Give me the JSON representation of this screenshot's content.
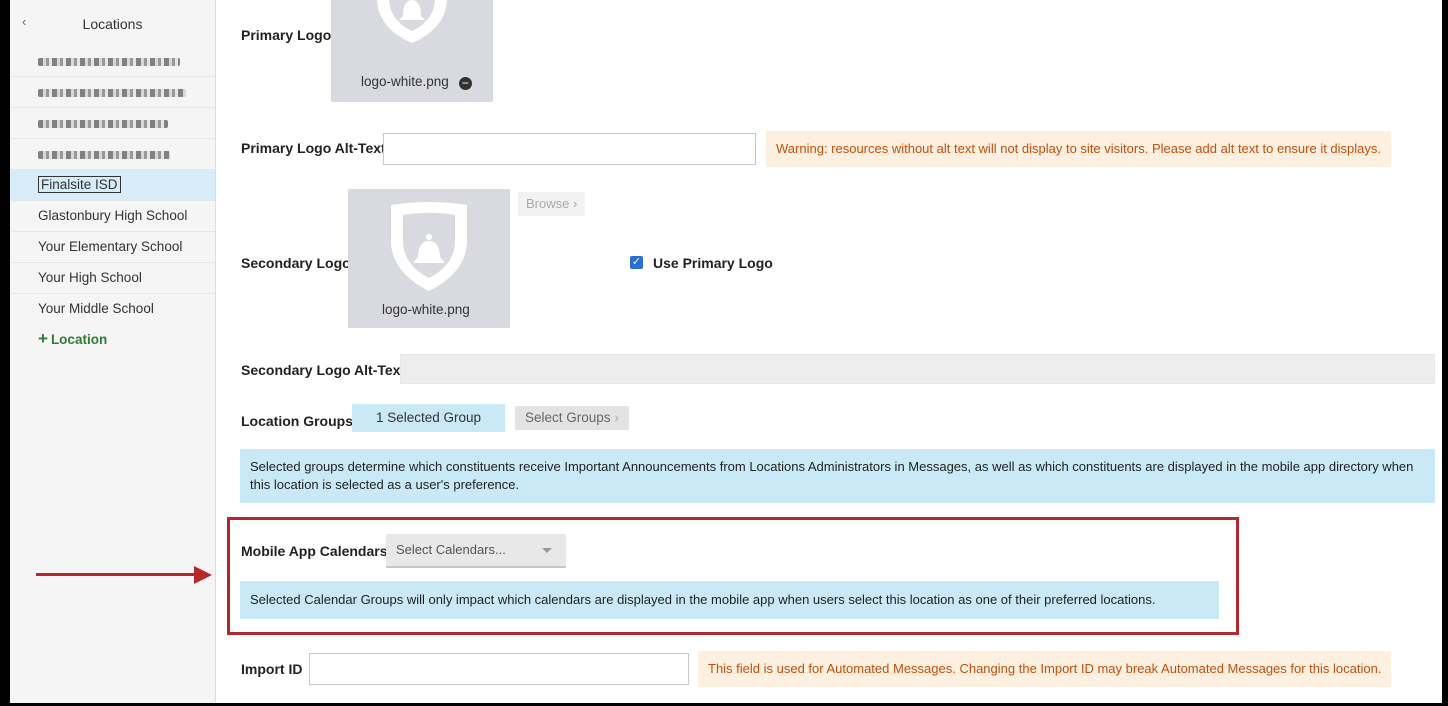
{
  "sidebar": {
    "title": "Locations",
    "collapse_icon": "chevron-left-icon",
    "blurred_items_count_note": "",
    "locations": [
      "Finalsite ISD",
      "Glastonbury High School",
      "Your Elementary School",
      "Your High School",
      "Your Middle School"
    ],
    "selected_location": "Finalsite ISD",
    "add_location_label": "Location"
  },
  "form": {
    "primary_logo_label": "Primary Logo",
    "primary_logo_file": "logo-white.png",
    "primary_logo_alt_label": "Primary Logo Alt-Text",
    "primary_logo_alt_value": "",
    "alt_text_warning": "Warning: resources without alt text will not display to site visitors. Please add alt text to ensure it displays.",
    "secondary_logo_label": "Secondary Logo",
    "secondary_logo_file": "logo-white.png",
    "browse_label": "Browse",
    "use_primary_logo_label": "Use Primary Logo",
    "use_primary_logo_checked": true,
    "secondary_logo_alt_label": "Secondary Logo Alt-Text",
    "location_groups_label": "Location Groups",
    "selected_groups_label": "1 Selected Group",
    "select_groups_label": "Select Groups",
    "groups_info": "Selected groups determine which constituents receive Important Announcements from Locations Administrators in Messages, as well as which constituents are displayed in the mobile app directory when this location is selected as a user's preference.",
    "mobile_calendars_label": "Mobile App Calendars",
    "select_calendars_placeholder": "Select Calendars...",
    "calendars_info": "Selected Calendar Groups will only impact which calendars are displayed in the mobile app when users select this location as one of their preferred locations.",
    "import_id_label": "Import ID",
    "import_id_value": "",
    "import_id_warning": "This field is used for Automated Messages. Changing the Import ID may break Automated Messages for this location."
  },
  "colors": {
    "annotation_red": "#b5272d",
    "info_blue": "#c9e9f6",
    "warning_bg": "#fdf0e1",
    "warning_text": "#c0500d",
    "add_green": "#2e7d32"
  }
}
